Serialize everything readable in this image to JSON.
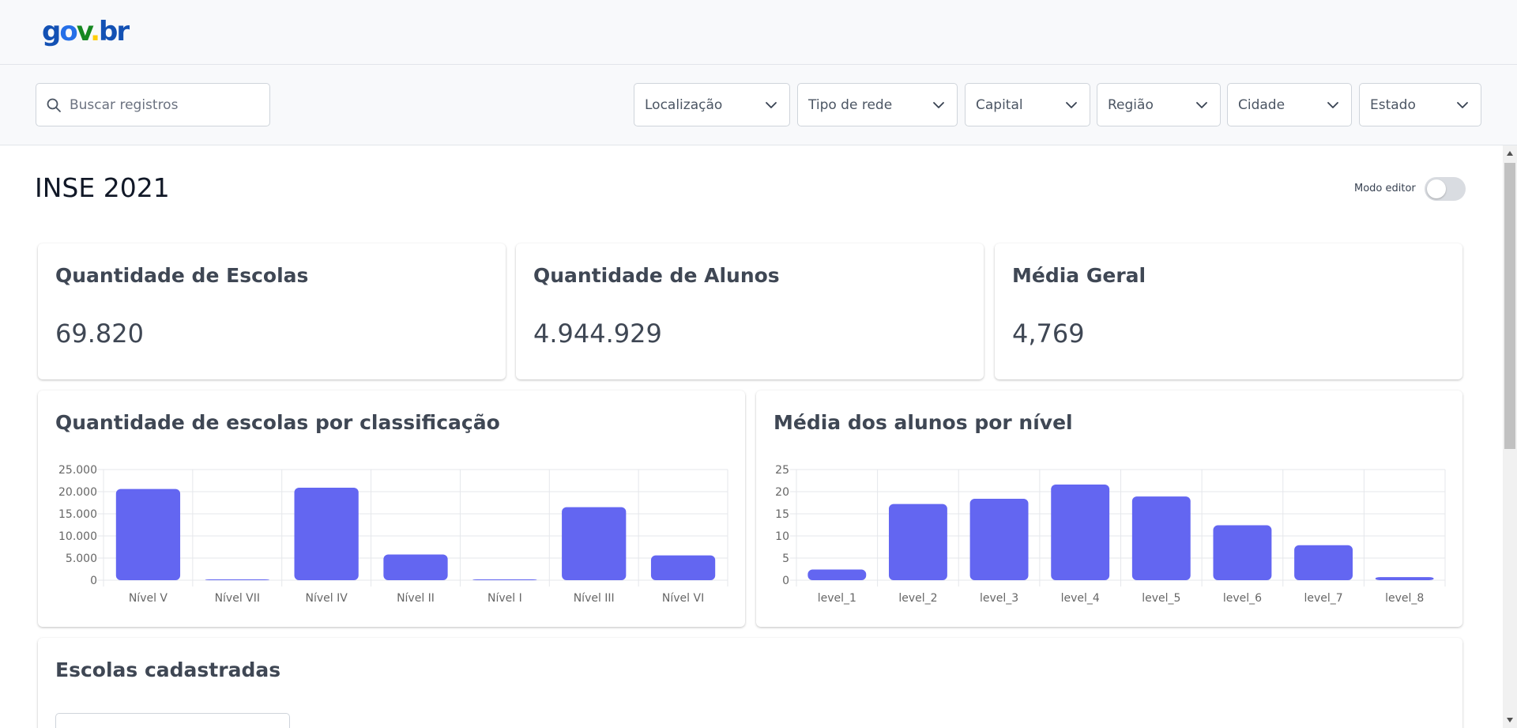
{
  "logo": {
    "g": "g",
    "o": "o",
    "v": "v",
    "dot": ".",
    "br": "br"
  },
  "search": {
    "placeholder": "Buscar registros"
  },
  "filters": [
    {
      "label": "Localização"
    },
    {
      "label": "Tipo de rede"
    },
    {
      "label": "Capital"
    },
    {
      "label": "Região"
    },
    {
      "label": "Cidade"
    },
    {
      "label": "Estado"
    }
  ],
  "page": {
    "title": "INSE 2021",
    "editor_mode_label": "Modo editor",
    "editor_mode_on": false
  },
  "stats": [
    {
      "title": "Quantidade de Escolas",
      "value": "69.820"
    },
    {
      "title": "Quantidade de Alunos",
      "value": "4.944.929"
    },
    {
      "title": "Média Geral",
      "value": "4,769"
    }
  ],
  "charts": {
    "schools_title": "Quantidade de escolas por classificação",
    "students_title": "Média dos alunos por nível"
  },
  "chart_data": [
    {
      "type": "bar",
      "title": "Quantidade de escolas por classificação",
      "categories": [
        "Nível V",
        "Nível VII",
        "Nível IV",
        "Nível II",
        "Nível I",
        "Nível III",
        "Nível VI"
      ],
      "values": [
        20600,
        80,
        20900,
        5800,
        30,
        16500,
        5600
      ],
      "ylim": [
        0,
        25000
      ],
      "yticks": [
        0,
        5000,
        10000,
        15000,
        20000,
        25000
      ],
      "ytick_labels": [
        "0",
        "5.000",
        "10.000",
        "15.000",
        "20.000",
        "25.000"
      ],
      "color": "#6366f1",
      "grid": true
    },
    {
      "type": "bar",
      "title": "Média dos alunos por nível",
      "categories": [
        "level_1",
        "level_2",
        "level_3",
        "level_4",
        "level_5",
        "level_6",
        "level_7",
        "level_8"
      ],
      "values": [
        2.4,
        17.2,
        18.4,
        21.6,
        18.9,
        12.4,
        7.9,
        0.7
      ],
      "ylim": [
        0,
        25
      ],
      "yticks": [
        0,
        5,
        10,
        15,
        20,
        25
      ],
      "ytick_labels": [
        "0",
        "5",
        "10",
        "15",
        "20",
        "25"
      ],
      "color": "#6366f1",
      "grid": true
    }
  ],
  "schools_section": {
    "title": "Escolas cadastradas"
  }
}
